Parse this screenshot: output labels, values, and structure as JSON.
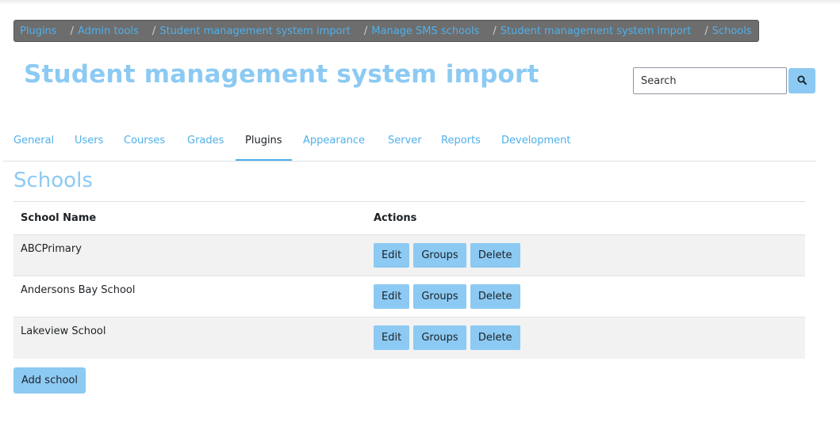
{
  "breadcrumb": [
    {
      "label": "Plugins"
    },
    {
      "label": "Admin tools"
    },
    {
      "label": "Student management system import"
    },
    {
      "label": "Manage SMS schools"
    },
    {
      "label": "Student management system import"
    },
    {
      "label": "Schools"
    }
  ],
  "header": {
    "title": "Student management system import",
    "search_placeholder": "Search",
    "search_icon": "search-icon"
  },
  "tabs": [
    {
      "label": "General"
    },
    {
      "label": "Users"
    },
    {
      "label": "Courses"
    },
    {
      "label": "Grades"
    },
    {
      "label": "Plugins",
      "active": true
    },
    {
      "label": "Appearance"
    },
    {
      "label": "Server"
    },
    {
      "label": "Reports"
    },
    {
      "label": "Development"
    }
  ],
  "section": {
    "title": "Schools"
  },
  "table": {
    "columns": [
      "School Name",
      "Actions"
    ],
    "rows": [
      {
        "name": "ABCPrimary",
        "actions": [
          "Edit",
          "Groups",
          "Delete"
        ]
      },
      {
        "name": "Andersons Bay School",
        "actions": [
          "Edit",
          "Groups",
          "Delete"
        ]
      },
      {
        "name": "Lakeview School",
        "actions": [
          "Edit",
          "Groups",
          "Delete"
        ]
      }
    ]
  },
  "add_button": "Add school",
  "colors": {
    "accent": "#8ccaf3",
    "link": "#4fb0ea",
    "breadcrumb_bg": "#6d6d6d"
  }
}
